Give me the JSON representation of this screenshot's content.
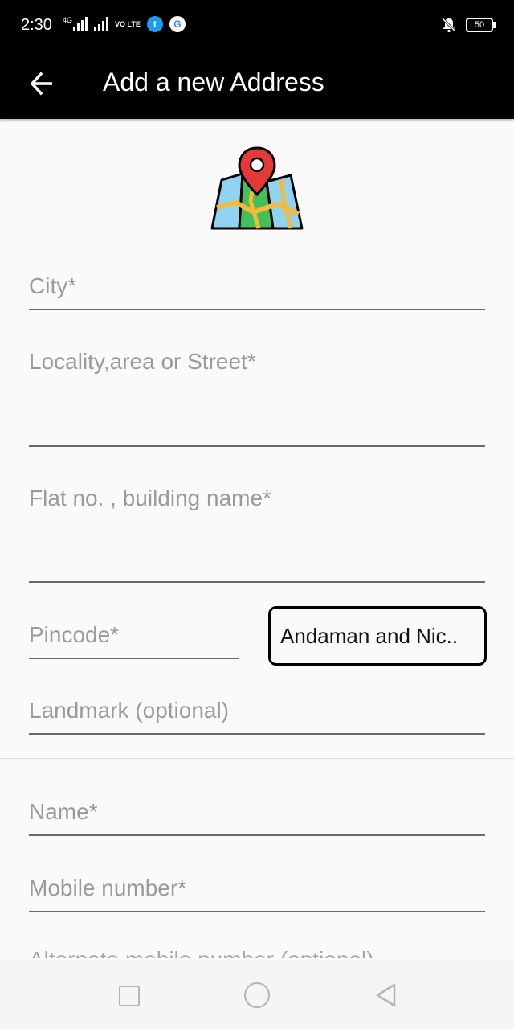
{
  "status_bar": {
    "time": "2:30",
    "network_label": "4G",
    "volte_label": "VO LTE",
    "battery": "50",
    "icons": [
      "signal-icon",
      "signal-icon",
      "twitter-icon",
      "google-icon",
      "mute-icon",
      "battery-icon"
    ]
  },
  "app_bar": {
    "back_icon": "arrow-left-icon",
    "title": "Add a new Address"
  },
  "header_icon": "map-pin-icon",
  "form": {
    "city": {
      "placeholder": "City*",
      "value": ""
    },
    "locality": {
      "placeholder": "Locality,area or Street*",
      "value": ""
    },
    "flat": {
      "placeholder": "Flat no. , building name*",
      "value": ""
    },
    "pincode": {
      "placeholder": "Pincode*",
      "value": ""
    },
    "state_selected": "Andaman and Nic..",
    "landmark": {
      "placeholder": "Landmark (optional)",
      "value": ""
    },
    "name": {
      "placeholder": "Name*",
      "value": ""
    },
    "mobile": {
      "placeholder": "Mobile number*",
      "value": ""
    },
    "alt_mobile_partial": "Alternate mobile number (optional)"
  },
  "colors": {
    "app_bar": "#000000",
    "underline": "#6b6b6b",
    "placeholder": "#9a9a9a",
    "pin_red": "#e53935",
    "map_green": "#43c059",
    "map_blue": "#8fd3f0",
    "map_yellow": "#f6b93b"
  }
}
